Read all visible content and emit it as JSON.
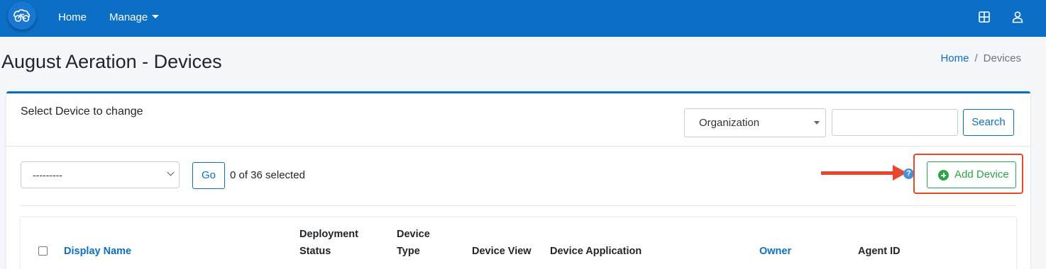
{
  "navbar": {
    "logo_icon": "bicycle-cloud-logo",
    "home_label": "Home",
    "manage_label": "Manage",
    "right_icons": [
      "grid-icon",
      "user-icon"
    ],
    "color": "#0b6fc6"
  },
  "page": {
    "title": "August Aeration - Devices",
    "breadcrumb": {
      "home": "Home",
      "separator": "/",
      "current": "Devices"
    }
  },
  "card": {
    "title": "Select Device to change",
    "filter": {
      "organization_value": "Organization",
      "search_value": "",
      "search_label": "Search"
    },
    "actions": {
      "action_value": "---------",
      "go_label": "Go",
      "selection_text": "0 of 36 selected"
    },
    "add_device": {
      "label": "Add Device",
      "help_glyph": "?"
    },
    "annotation_color": "#e8472b"
  },
  "table": {
    "headers": [
      {
        "key": "display_name",
        "label": "Display Name",
        "sortable": true
      },
      {
        "key": "deployment_status",
        "label": "Deployment Status",
        "line1": "Deployment",
        "line2": "Status",
        "sortable": false
      },
      {
        "key": "device_type",
        "label": "Device Type",
        "line1": "Device",
        "line2": "Type",
        "sortable": false
      },
      {
        "key": "device_view",
        "label": "Device View",
        "sortable": false
      },
      {
        "key": "device_application",
        "label": "Device Application",
        "sortable": false
      },
      {
        "key": "owner",
        "label": "Owner",
        "sortable": true
      },
      {
        "key": "agent_id",
        "label": "Agent ID",
        "sortable": false
      }
    ],
    "select_all_checked": false
  }
}
